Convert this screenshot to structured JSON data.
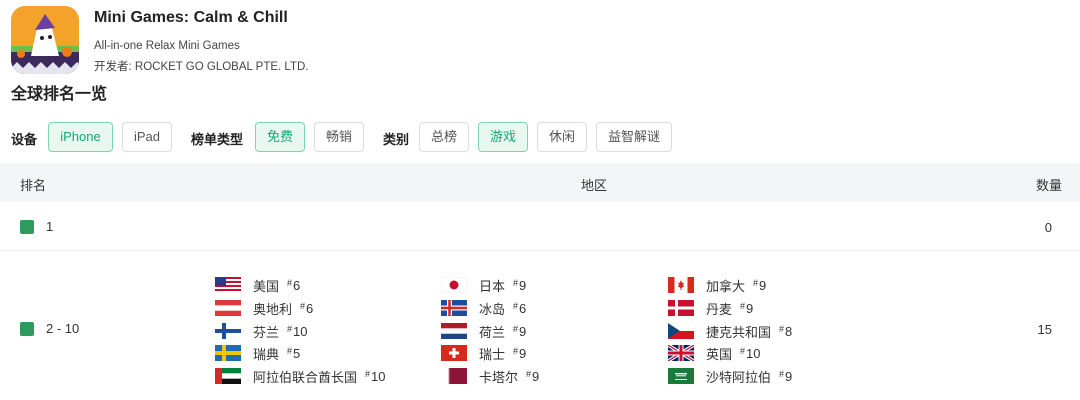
{
  "app": {
    "title": "Mini Games: Calm & Chill",
    "subtitle": "All-in-one Relax Mini Games",
    "developer": "开发者: ROCKET GO GLOBAL PTE. LTD."
  },
  "section_title": "全球排名一览",
  "filters": {
    "device_label": "设备",
    "device_options": [
      "iPhone",
      "iPad"
    ],
    "device_selected": "iPhone",
    "chart_type_label": "榜单类型",
    "chart_type_options": [
      "免费",
      "畅销"
    ],
    "chart_type_selected": "免费",
    "category_label": "类别",
    "category_options": [
      "总榜",
      "游戏",
      "休闲",
      "益智解谜"
    ],
    "category_selected": "游戏"
  },
  "table": {
    "headers": [
      "排名",
      "地区",
      "数量"
    ],
    "rows": [
      {
        "rank": "1",
        "count": "0",
        "color": "#2e9a5e"
      },
      {
        "rank": "2 - 10",
        "count": "15",
        "color": "#2e9a5e"
      }
    ],
    "countries": [
      {
        "name": "美国",
        "rank": "6",
        "flag": "us-flag"
      },
      {
        "name": "奥地利",
        "rank": "6",
        "flag": "austria-flag"
      },
      {
        "name": "芬兰",
        "rank": "10",
        "flag": "finland-flag"
      },
      {
        "name": "瑞典",
        "rank": "5",
        "flag": "sweden-flag"
      },
      {
        "name": "阿拉伯联合酋长国",
        "rank": "10",
        "flag": "uae-flag"
      },
      {
        "name": "日本",
        "rank": "9",
        "flag": "japan-flag"
      },
      {
        "name": "冰岛",
        "rank": "6",
        "flag": "iceland-flag"
      },
      {
        "name": "荷兰",
        "rank": "9",
        "flag": "netherlands-flag"
      },
      {
        "name": "瑞士",
        "rank": "9",
        "flag": "switzerland-flag"
      },
      {
        "name": "卡塔尔",
        "rank": "9",
        "flag": "qatar-flag"
      },
      {
        "name": "加拿大",
        "rank": "9",
        "flag": "canada-flag"
      },
      {
        "name": "丹麦",
        "rank": "9",
        "flag": "denmark-flag"
      },
      {
        "name": "捷克共和国",
        "rank": "8",
        "flag": "czech-flag"
      },
      {
        "name": "英国",
        "rank": "10",
        "flag": "uk-flag"
      },
      {
        "name": "沙特阿拉伯",
        "rank": "9",
        "flag": "saudi-flag"
      }
    ]
  },
  "colors": {
    "accent": "#1aa572",
    "accent_bg": "#e8f8f1",
    "rank_square": "#2e9a5e",
    "header_bg": "#f3f5f7"
  }
}
